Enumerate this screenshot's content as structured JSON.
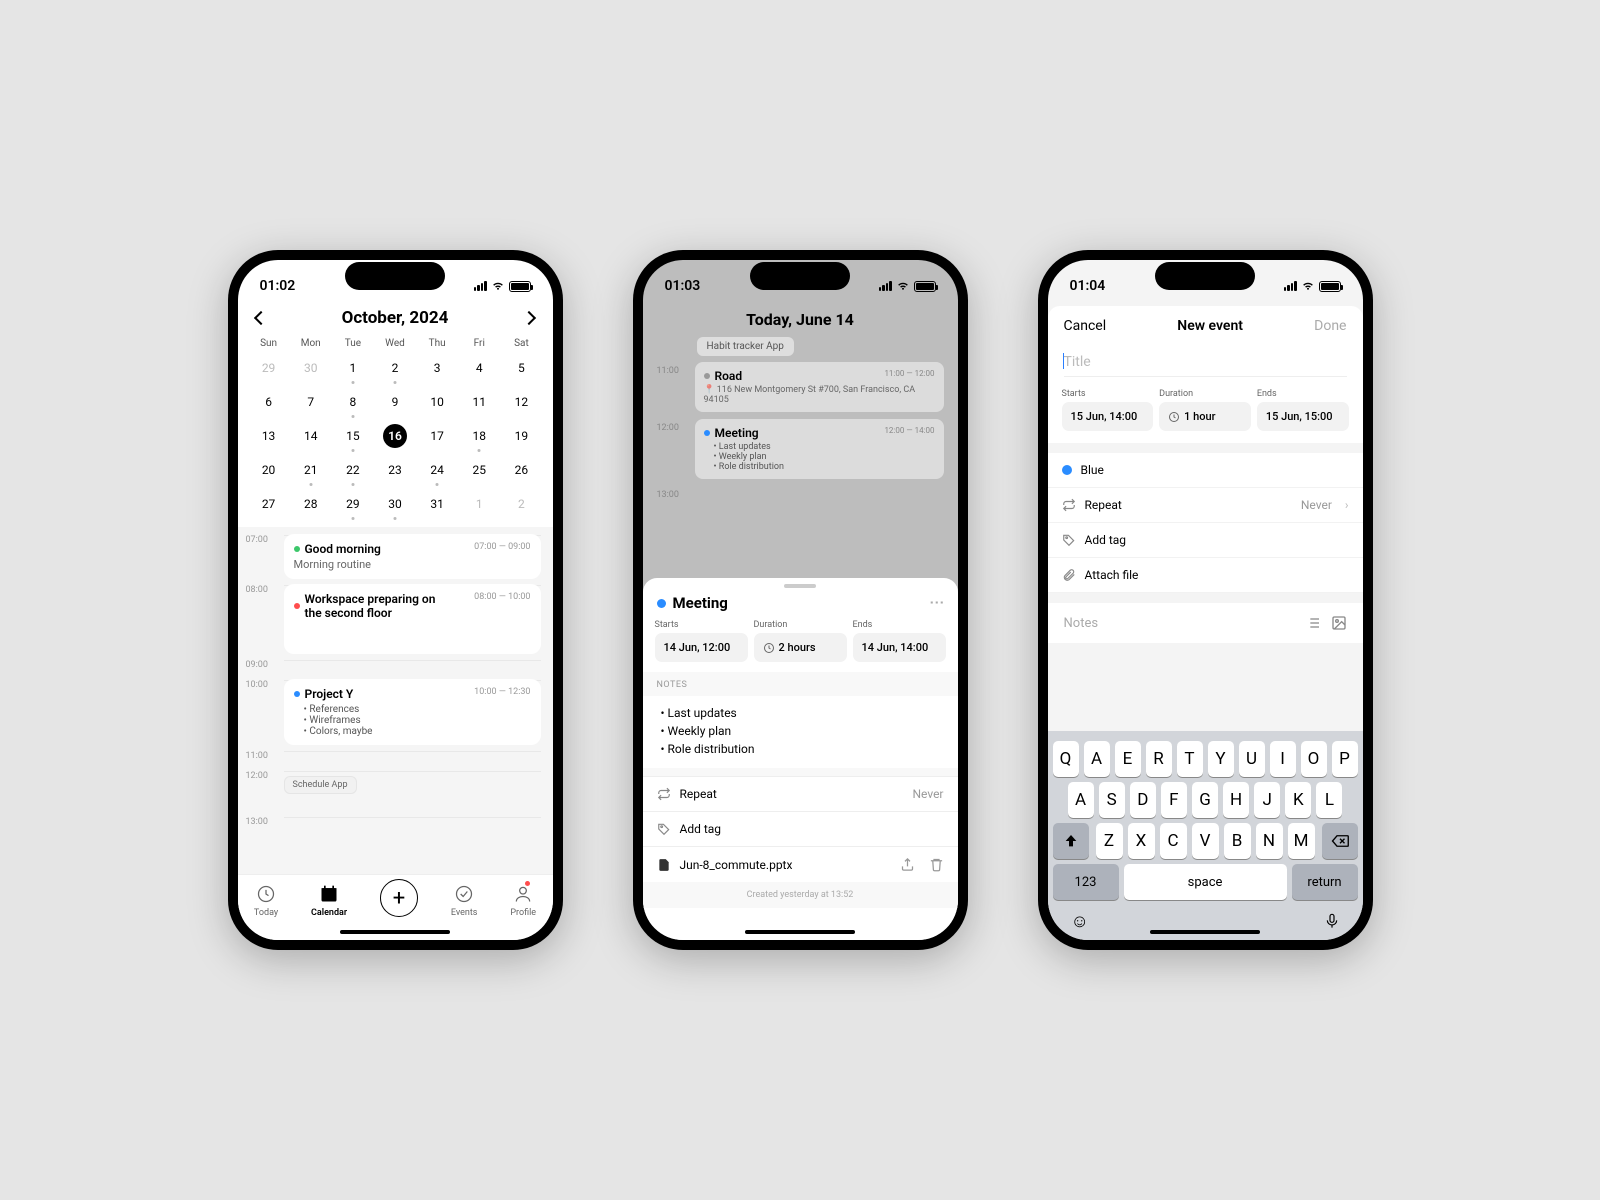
{
  "screen1": {
    "time": "01:02",
    "month_title": "October, 2024",
    "weekdays": [
      "Sun",
      "Mon",
      "Tue",
      "Wed",
      "Thu",
      "Fri",
      "Sat"
    ],
    "weeks": [
      [
        {
          "n": "29",
          "dim": true
        },
        {
          "n": "30",
          "dim": true
        },
        {
          "n": "1",
          "dot": true
        },
        {
          "n": "2",
          "dot": true
        },
        {
          "n": "3"
        },
        {
          "n": "4"
        },
        {
          "n": "5"
        }
      ],
      [
        {
          "n": "6"
        },
        {
          "n": "7"
        },
        {
          "n": "8",
          "dot": true
        },
        {
          "n": "9"
        },
        {
          "n": "10"
        },
        {
          "n": "11"
        },
        {
          "n": "12"
        }
      ],
      [
        {
          "n": "13"
        },
        {
          "n": "14"
        },
        {
          "n": "15",
          "dot": true
        },
        {
          "n": "16",
          "sel": true
        },
        {
          "n": "17"
        },
        {
          "n": "18",
          "dot": true
        },
        {
          "n": "19"
        }
      ],
      [
        {
          "n": "20"
        },
        {
          "n": "21",
          "dot": true
        },
        {
          "n": "22",
          "dot": true
        },
        {
          "n": "23"
        },
        {
          "n": "24",
          "dot": true
        },
        {
          "n": "25"
        },
        {
          "n": "26"
        }
      ],
      [
        {
          "n": "27"
        },
        {
          "n": "28"
        },
        {
          "n": "29",
          "dot": true
        },
        {
          "n": "30",
          "dot": true
        },
        {
          "n": "31"
        },
        {
          "n": "1",
          "dim": true
        },
        {
          "n": "2",
          "dim": true
        }
      ]
    ],
    "hours": [
      "07:00",
      "08:00",
      "09:00",
      "10:00",
      "11:00",
      "12:00",
      "13:00"
    ],
    "events": {
      "e1": {
        "title": "Good morning",
        "time": "07:00 — 09:00",
        "sub": "Morning routine",
        "color": "#3cc76a"
      },
      "e2": {
        "title": "Workspace preparing on the second floor",
        "time": "08:00 — 10:00",
        "color": "#ff4d4d"
      },
      "e3": {
        "title": "Project Y",
        "time": "10:00 — 12:30",
        "color": "#2a8cff",
        "items": [
          "References",
          "Wireframes",
          "Colors, maybe"
        ],
        "badge": "Schedule App"
      }
    },
    "tabs": {
      "today": "Today",
      "calendar": "Calendar",
      "events": "Events",
      "profile": "Profile"
    }
  },
  "screen2": {
    "time": "01:03",
    "title": "Today, June 14",
    "chip": "Habit tracker App",
    "bg": {
      "road": {
        "title": "Road",
        "time": "11:00 — 12:00",
        "addr": "116 New Montgomery St #700, San Francisco, CA 94105"
      },
      "meeting": {
        "title": "Meeting",
        "time": "12:00 — 14:00",
        "items": [
          "Last updates",
          "Weekly plan",
          "Role distribution"
        ]
      },
      "h1": "11:00",
      "h2": "12:00",
      "h3": "13:00"
    },
    "sheet": {
      "title": "Meeting",
      "color": "#2a8cff",
      "starts_lb": "Starts",
      "starts": "14 Jun, 12:00",
      "dur_lb": "Duration",
      "dur": "2 hours",
      "ends_lb": "Ends",
      "ends": "14 Jun, 14:00",
      "notes_lb": "Notes",
      "notes": [
        "Last updates",
        "Weekly plan",
        "Role distribution"
      ],
      "repeat_lb": "Repeat",
      "repeat_val": "Never",
      "tag_lb": "Add tag",
      "file": "Jun-8_commute.pptx",
      "created": "Created yesterday at 13:52"
    }
  },
  "screen3": {
    "time": "01:04",
    "cancel": "Cancel",
    "title": "New event",
    "done": "Done",
    "title_ph": "Title",
    "starts_lb": "Starts",
    "starts": "15 Jun, 14:00",
    "dur_lb": "Duration",
    "dur": "1 hour",
    "ends_lb": "Ends",
    "ends": "15 Jun, 15:00",
    "color_lb": "Blue",
    "color": "#2a8cff",
    "repeat_lb": "Repeat",
    "repeat_val": "Never",
    "tag_lb": "Add tag",
    "file_lb": "Attach file",
    "notes_ph": "Notes",
    "kb": {
      "r1": [
        "Q",
        "A",
        "E",
        "R",
        "T",
        "Y",
        "U",
        "I",
        "O",
        "P"
      ],
      "r2": [
        "A",
        "S",
        "D",
        "F",
        "G",
        "H",
        "J",
        "K",
        "L"
      ],
      "r3": [
        "Z",
        "X",
        "C",
        "V",
        "B",
        "N",
        "M"
      ],
      "n123": "123",
      "space": "space",
      "ret": "return"
    }
  }
}
